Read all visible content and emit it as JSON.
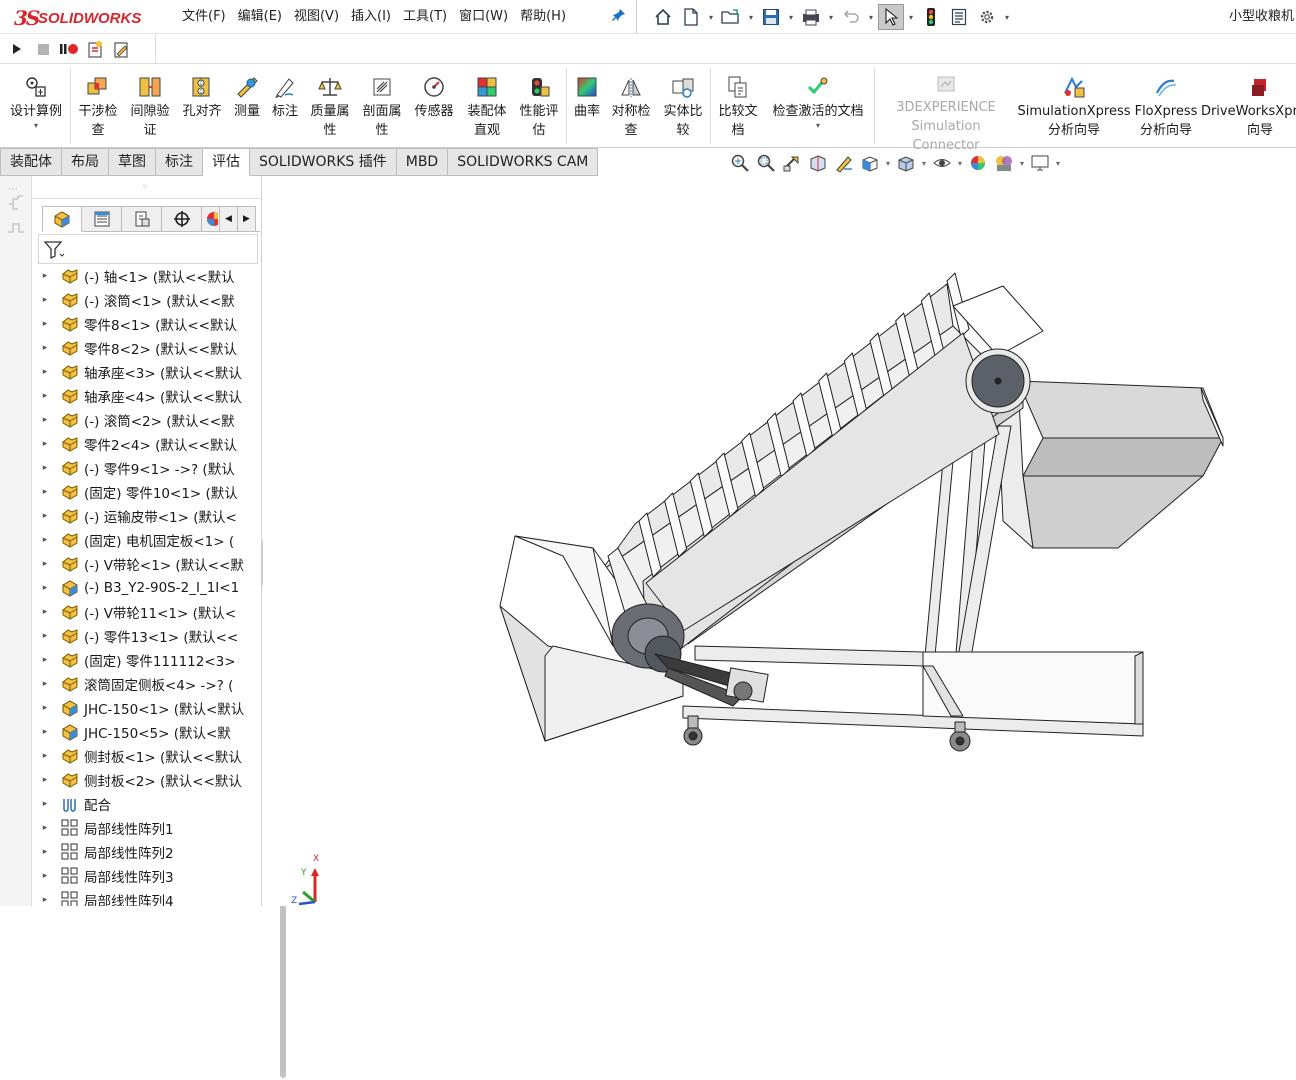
{
  "app": {
    "logo_prefix": "3S",
    "logo_name": "SOLIDWORKS",
    "document_title": "小型收粮机"
  },
  "menu": [
    "文件(F)",
    "编辑(E)",
    "视图(V)",
    "插入(I)",
    "工具(T)",
    "窗口(W)",
    "帮助(H)"
  ],
  "quick_access": [
    "home-icon",
    "new-document-icon",
    "open-folder-icon",
    "save-icon",
    "print-icon",
    "undo-icon",
    "select-pointer-icon",
    "rebuild-traffic-light-icon",
    "file-properties-icon",
    "options-gear-icon"
  ],
  "macro_bar": [
    "play-icon",
    "stop-icon",
    "pause-record-icon",
    "new-macro-icon",
    "edit-macro-icon"
  ],
  "commands": [
    {
      "label": "设计算例",
      "icon": "design-study-icon"
    },
    {
      "label": "干涉检\n查",
      "icon": "interference-check-icon"
    },
    {
      "label": "间隙验\n证",
      "icon": "clearance-verify-icon"
    },
    {
      "label": "孔对齐",
      "icon": "hole-alignment-icon"
    },
    {
      "label": "测量",
      "icon": "measure-icon"
    },
    {
      "label": "标注",
      "icon": "markup-icon"
    },
    {
      "label": "质量属\n性",
      "icon": "mass-properties-icon"
    },
    {
      "label": "剖面属\n性",
      "icon": "section-properties-icon"
    },
    {
      "label": "传感器",
      "icon": "sensor-icon"
    },
    {
      "label": "装配体\n直观",
      "icon": "assembly-visualization-icon"
    },
    {
      "label": "性能评\n估",
      "icon": "performance-evaluation-icon"
    },
    {
      "label": "曲率",
      "icon": "curvature-icon"
    },
    {
      "label": "对称检\n查",
      "icon": "symmetry-check-icon"
    },
    {
      "label": "实体比\n较",
      "icon": "compare-bodies-icon"
    },
    {
      "label": "比较文\n档",
      "icon": "compare-documents-icon"
    },
    {
      "label": "检查激活的文档",
      "icon": "check-active-document-icon"
    },
    {
      "label": "3DEXPERIENCE\nSimulation Connector",
      "icon": "3dexperience-icon"
    },
    {
      "label": "SimulationXpress\n分析向导",
      "icon": "simulationxpress-icon"
    },
    {
      "label": "FloXpress\n分析向导",
      "icon": "floxpress-icon"
    },
    {
      "label": "DriveWorksXpress\n向导",
      "icon": "driveworksxpress-icon"
    }
  ],
  "tabs": [
    "装配体",
    "布局",
    "草图",
    "标注",
    "评估",
    "SOLIDWORKS 插件",
    "MBD",
    "SOLIDWORKS CAM"
  ],
  "active_tab": "评估",
  "view_toolbar": [
    "zoom-to-fit-icon",
    "zoom-to-area-icon",
    "previous-view-icon",
    "section-view-icon",
    "dynamic-annotation-icon",
    "view-orientation-icon",
    "display-style-icon",
    "hide-show-items-icon",
    "edit-appearance-icon",
    "apply-scene-icon",
    "view-settings-icon"
  ],
  "feature_tabs": [
    "feature-manager-icon",
    "property-manager-icon",
    "configuration-manager-icon",
    "dimxpert-icon",
    "display-manager-icon"
  ],
  "tree": [
    {
      "label": "(-) 轴<1> (默认<<默认",
      "icon": "part-icon"
    },
    {
      "label": "(-) 滚筒<1> (默认<<默",
      "icon": "part-icon"
    },
    {
      "label": "零件8<1> (默认<<默认",
      "icon": "part-icon"
    },
    {
      "label": "零件8<2> (默认<<默认",
      "icon": "part-icon"
    },
    {
      "label": "轴承座<3> (默认<<默认",
      "icon": "part-icon"
    },
    {
      "label": "轴承座<4> (默认<<默认",
      "icon": "part-icon"
    },
    {
      "label": "(-) 滚筒<2> (默认<<默",
      "icon": "part-icon"
    },
    {
      "label": "零件2<4> (默认<<默认",
      "icon": "part-icon"
    },
    {
      "label": "(-) 零件9<1> ->? (默认",
      "icon": "part-icon"
    },
    {
      "label": "(固定) 零件10<1> (默认",
      "icon": "part-icon"
    },
    {
      "label": "(-) 运输皮带<1> (默认<",
      "icon": "part-icon"
    },
    {
      "label": "(固定) 电机固定板<1> (",
      "icon": "part-icon"
    },
    {
      "label": "(-) V带轮<1> (默认<<默",
      "icon": "part-icon"
    },
    {
      "label": "(-) B3_Y2-90S-2_I_1I<1",
      "icon": "assembly-icon"
    },
    {
      "label": "(-) V带轮11<1> (默认<",
      "icon": "part-icon"
    },
    {
      "label": "(-) 零件13<1> (默认<<",
      "icon": "part-icon"
    },
    {
      "label": "(固定) 零件111112<3>",
      "icon": "part-icon"
    },
    {
      "label": "滚筒固定侧板<4> ->? (",
      "icon": "part-icon"
    },
    {
      "label": "JHC-150<1> (默认<默认",
      "icon": "assembly-icon"
    },
    {
      "label": "JHC-150<5> (默认<默",
      "icon": "assembly-icon"
    },
    {
      "label": "侧封板<1> (默认<<默认",
      "icon": "part-icon"
    },
    {
      "label": "侧封板<2> (默认<<默认",
      "icon": "part-icon"
    },
    {
      "label": "配合",
      "icon": "mates-icon"
    },
    {
      "label": "局部线性阵列1",
      "icon": "linear-pattern-icon"
    },
    {
      "label": "局部线性阵列2",
      "icon": "linear-pattern-icon"
    },
    {
      "label": "局部线性阵列3",
      "icon": "linear-pattern-icon"
    },
    {
      "label": "局部线性阵列4",
      "icon": "linear-pattern-icon"
    }
  ],
  "triad": {
    "x": "X",
    "y": "Y",
    "z": "Z"
  },
  "colors": {
    "brand": "#d9262e",
    "accent": "#1a73c9",
    "part": "#e8b64c"
  }
}
